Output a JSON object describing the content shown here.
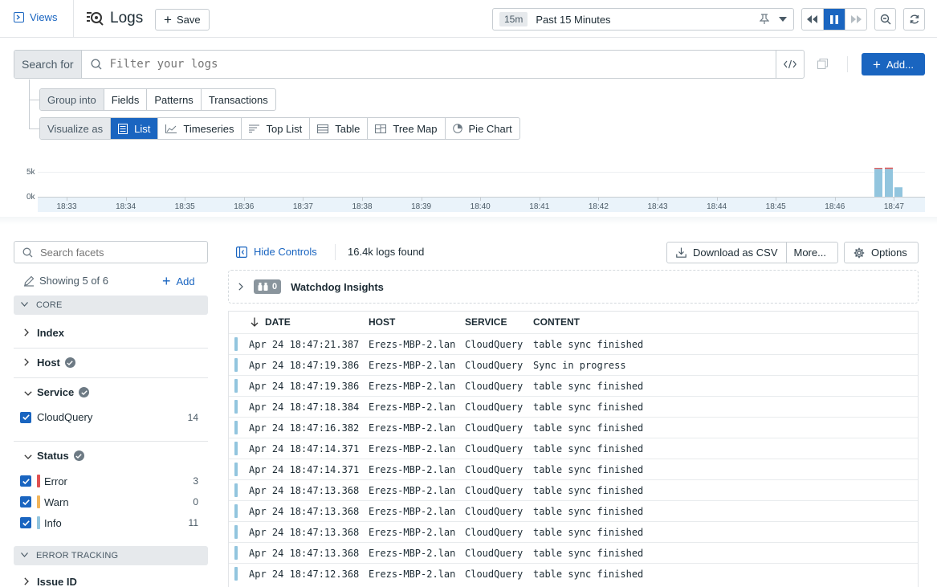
{
  "header": {
    "views_label": "Views",
    "title": "Logs",
    "save_label": "Save",
    "time_badge": "15m",
    "time_range": "Past 15 Minutes"
  },
  "search": {
    "label": "Search for",
    "placeholder": "Filter your logs",
    "add_label": "Add..."
  },
  "group_into": {
    "label": "Group into",
    "options": [
      "Fields",
      "Patterns",
      "Transactions"
    ]
  },
  "visualize_as": {
    "label": "Visualize as",
    "options": [
      "List",
      "Timeseries",
      "Top List",
      "Table",
      "Tree Map",
      "Pie Chart"
    ],
    "selected": "List"
  },
  "chart_data": {
    "type": "bar",
    "y_ticks": [
      "5k",
      "0k"
    ],
    "x_ticks": [
      "18:33",
      "18:34",
      "18:35",
      "18:36",
      "18:37",
      "18:38",
      "18:39",
      "18:40",
      "18:41",
      "18:42",
      "18:43",
      "18:44",
      "18:45",
      "18:46",
      "18:47"
    ],
    "series": [
      {
        "values_info": [
          5600,
          5600,
          1900
        ],
        "values_error": [
          200,
          250,
          0
        ]
      }
    ],
    "colors": {
      "info": "#92c5de",
      "error": "#e05252"
    }
  },
  "facets": {
    "search_placeholder": "Search facets",
    "showing": "Showing 5 of 6",
    "add_label": "Add",
    "core_label": "CORE",
    "index_label": "Index",
    "host_label": "Host",
    "service_label": "Service",
    "service_items": [
      {
        "name": "CloudQuery",
        "count": "14"
      }
    ],
    "status_label": "Status",
    "status_items": [
      {
        "name": "Error",
        "count": "3",
        "color": "#e05252"
      },
      {
        "name": "Warn",
        "count": "0",
        "color": "#f2b55b"
      },
      {
        "name": "Info",
        "count": "11",
        "color": "#92c5de"
      }
    ],
    "error_tracking_label": "ERROR TRACKING",
    "issue_id_label": "Issue ID"
  },
  "results": {
    "hide_controls": "Hide Controls",
    "count": "16.4k logs found",
    "download": "Download as CSV",
    "more": "More...",
    "options": "Options",
    "watchdog_count": "0",
    "watchdog_label": "Watchdog Insights"
  },
  "table": {
    "columns": [
      "DATE",
      "HOST",
      "SERVICE",
      "CONTENT"
    ],
    "rows": [
      [
        "Apr 24 18:47:21.387",
        "Erezs-MBP-2.lan",
        "CloudQuery",
        "table sync finished"
      ],
      [
        "Apr 24 18:47:19.386",
        "Erezs-MBP-2.lan",
        "CloudQuery",
        "Sync in progress"
      ],
      [
        "Apr 24 18:47:19.386",
        "Erezs-MBP-2.lan",
        "CloudQuery",
        "table sync finished"
      ],
      [
        "Apr 24 18:47:18.384",
        "Erezs-MBP-2.lan",
        "CloudQuery",
        "table sync finished"
      ],
      [
        "Apr 24 18:47:16.382",
        "Erezs-MBP-2.lan",
        "CloudQuery",
        "table sync finished"
      ],
      [
        "Apr 24 18:47:14.371",
        "Erezs-MBP-2.lan",
        "CloudQuery",
        "table sync finished"
      ],
      [
        "Apr 24 18:47:14.371",
        "Erezs-MBP-2.lan",
        "CloudQuery",
        "table sync finished"
      ],
      [
        "Apr 24 18:47:13.368",
        "Erezs-MBP-2.lan",
        "CloudQuery",
        "table sync finished"
      ],
      [
        "Apr 24 18:47:13.368",
        "Erezs-MBP-2.lan",
        "CloudQuery",
        "table sync finished"
      ],
      [
        "Apr 24 18:47:13.368",
        "Erezs-MBP-2.lan",
        "CloudQuery",
        "table sync finished"
      ],
      [
        "Apr 24 18:47:13.368",
        "Erezs-MBP-2.lan",
        "CloudQuery",
        "table sync finished"
      ],
      [
        "Apr 24 18:47:12.368",
        "Erezs-MBP-2.lan",
        "CloudQuery",
        "table sync finished"
      ]
    ]
  }
}
